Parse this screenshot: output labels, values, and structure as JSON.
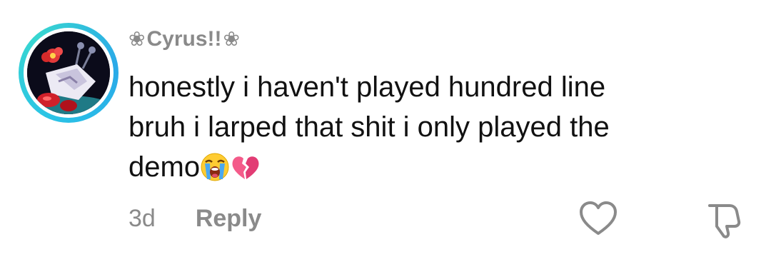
{
  "comment": {
    "username": "❀Cyrus!!❀",
    "username_core": "Cyrus!!",
    "username_decoration": "❀",
    "lines": [
      "honestly i haven't played hundred line",
      "bruh i larped that shit i only played the",
      "demo"
    ],
    "emojis": [
      "loudly-crying-face",
      "broken-heart"
    ],
    "time": "3d",
    "reply_label": "Reply"
  },
  "colors": {
    "ring": "#2ac3e6",
    "meta_text": "#8a8a8a",
    "body_text": "#111111",
    "heart_outline": "#8a8a8a"
  },
  "icons": {
    "like": "heart-outline-icon",
    "dislike": "thumbs-down-outline-icon"
  }
}
